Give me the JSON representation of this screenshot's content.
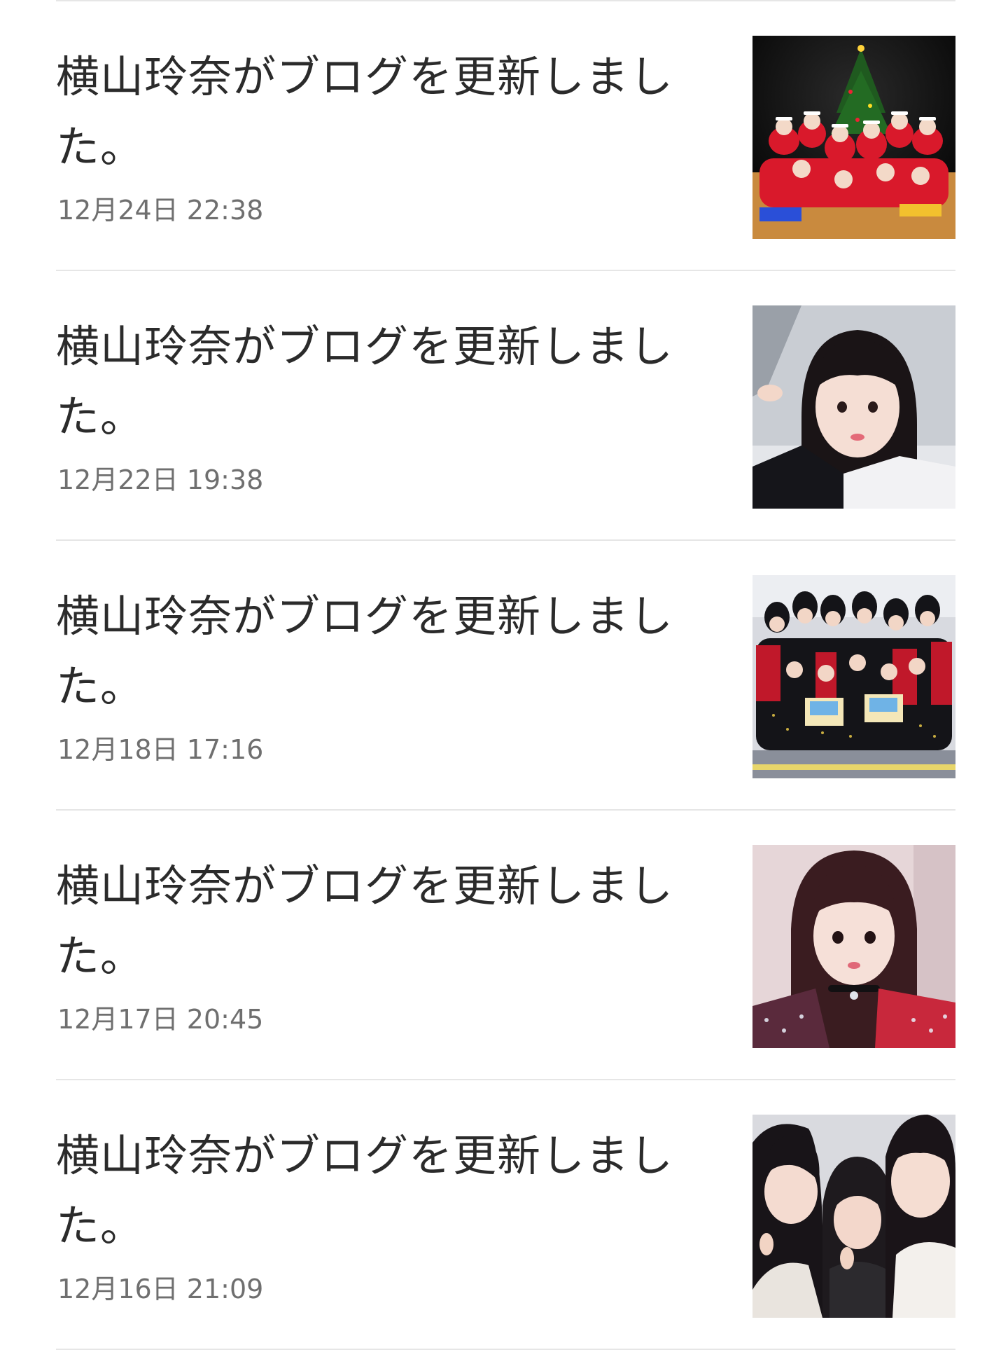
{
  "entries": [
    {
      "title": "横山玲奈がブログを更新しました。",
      "date": "12月24日 22:38",
      "thumb_icon": "group-christmas-photo"
    },
    {
      "title": "横山玲奈がブログを更新しました。",
      "date": "12月22日 19:38",
      "thumb_icon": "selfie-photo"
    },
    {
      "title": "横山玲奈がブログを更新しました。",
      "date": "12月18日 17:16",
      "thumb_icon": "group-stage-photo"
    },
    {
      "title": "横山玲奈がブログを更新しました。",
      "date": "12月17日 20:45",
      "thumb_icon": "portrait-photo"
    },
    {
      "title": "横山玲奈がブログを更新しました。",
      "date": "12月16日 21:09",
      "thumb_icon": "trio-selfie-photo"
    }
  ],
  "colors": {
    "divider": "#e6e6e6",
    "title": "#2b2b2b",
    "date": "#6f6f6f"
  }
}
